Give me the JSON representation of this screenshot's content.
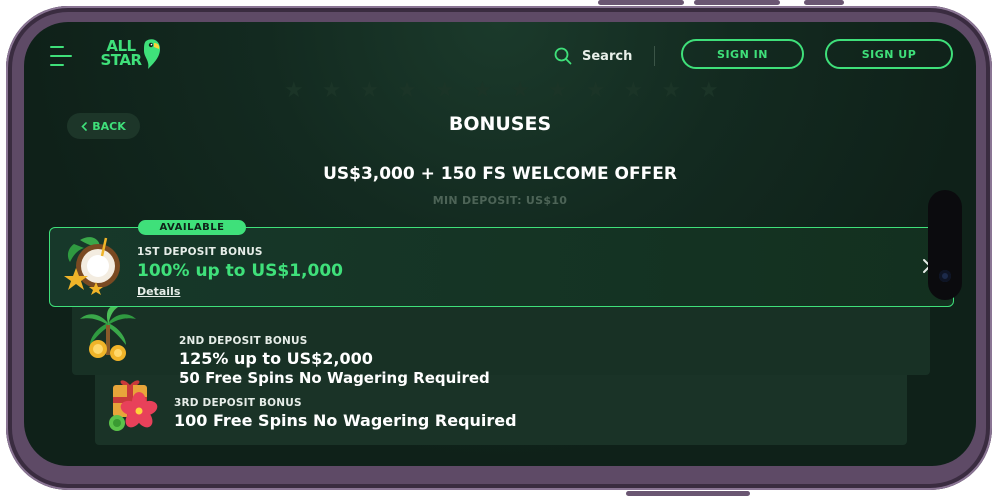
{
  "header": {
    "logo_line1": "ALL",
    "logo_line2": "STAR",
    "search_label": "Search",
    "sign_in_label": "SIGN IN",
    "sign_up_label": "SIGN UP"
  },
  "nav": {
    "back_label": "BACK",
    "page_title": "BONUSES"
  },
  "offer": {
    "title": "US$3,000 + 150 FS WELCOME OFFER",
    "min_deposit": "MIN DEPOSIT: US$10"
  },
  "bonuses": [
    {
      "badge": "AVAILABLE",
      "label": "1ST DEPOSIT BONUS",
      "headline": "100% up to US$1,000",
      "details_link": "Details",
      "icon": "coconut-star-icon"
    },
    {
      "label": "2ND DEPOSIT BONUS",
      "headline": "125% up to US$2,000",
      "subline": "50 Free Spins No Wagering Required",
      "icon": "palm-coins-icon"
    },
    {
      "label": "3RD DEPOSIT BONUS",
      "headline": "100 Free Spins No Wagering Required",
      "icon": "hibiscus-gift-icon"
    }
  ],
  "colors": {
    "accent": "#3fe07a",
    "background": "#0f2119",
    "text": "#ffffff",
    "muted": "#4d6457"
  }
}
